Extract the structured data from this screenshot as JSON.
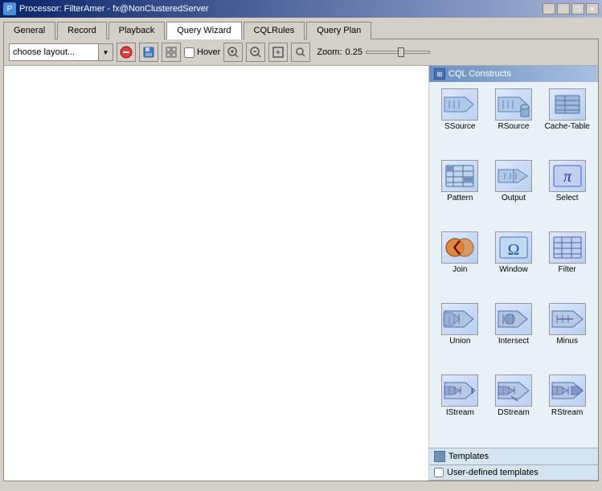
{
  "window": {
    "title": "Processor: FilterAmer - fx@NonClusteredServer",
    "icon": "P"
  },
  "tabs": [
    {
      "label": "General",
      "active": false
    },
    {
      "label": "Record",
      "active": false
    },
    {
      "label": "Playback",
      "active": false
    },
    {
      "label": "Query Wizard",
      "active": true
    },
    {
      "label": "CQLRules",
      "active": false
    },
    {
      "label": "Query Plan",
      "active": false
    }
  ],
  "toolbar": {
    "layout_placeholder": "choose layout...",
    "hover_label": "Hover",
    "zoom_label": "Zoom:",
    "zoom_value": "0.25"
  },
  "cql_constructs": {
    "header": "CQL Constructs",
    "items": [
      {
        "id": "ssource",
        "label": "SSource",
        "type": "stream-arrow"
      },
      {
        "id": "rsource",
        "label": "RSource",
        "type": "stream-arrow-db"
      },
      {
        "id": "cachetable",
        "label": "Cache-Table",
        "type": "db-table"
      },
      {
        "id": "pattern",
        "label": "Pattern",
        "type": "grid-pattern"
      },
      {
        "id": "output",
        "label": "Output",
        "type": "output-arrow"
      },
      {
        "id": "select",
        "label": "Select",
        "type": "pi-symbol"
      },
      {
        "id": "join",
        "label": "Join",
        "type": "join-circle"
      },
      {
        "id": "window",
        "label": "Window",
        "type": "omega"
      },
      {
        "id": "filter",
        "label": "Filter",
        "type": "filter-grid"
      },
      {
        "id": "union",
        "label": "Union",
        "type": "union-arrow"
      },
      {
        "id": "intersect",
        "label": "Intersect",
        "type": "intersect-arrow"
      },
      {
        "id": "minus",
        "label": "Minus",
        "type": "minus-arrow"
      },
      {
        "id": "istream",
        "label": "IStream",
        "type": "istream-arrow"
      },
      {
        "id": "dstream",
        "label": "DStream",
        "type": "dstream-arrow"
      },
      {
        "id": "rstream",
        "label": "RStream",
        "type": "rstream-arrow"
      }
    ]
  },
  "bottom_panel": {
    "templates_label": "Templates",
    "user_templates_label": "User-defined templates"
  }
}
